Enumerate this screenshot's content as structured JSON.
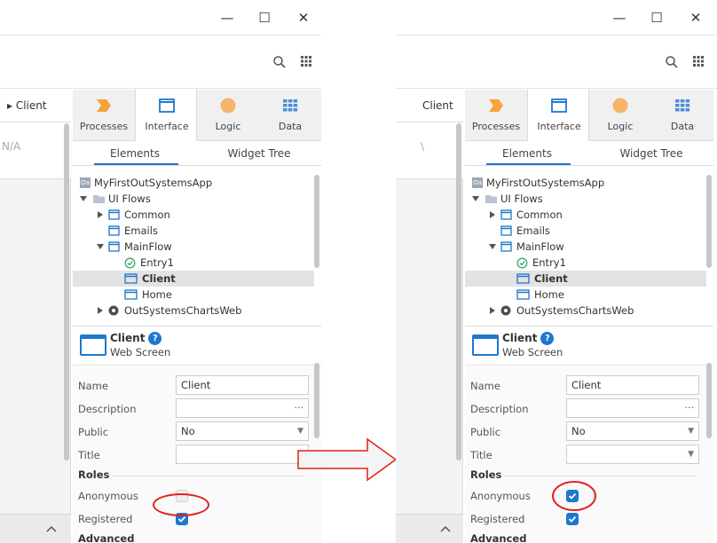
{
  "colors": {
    "accent": "#1f77d0",
    "annotation_red": "#e0201b",
    "processes_orange": "#f6a33a",
    "logic_orange": "#f5b56a"
  },
  "window": {
    "minimize_glyph": "—",
    "maximize_glyph": "☐",
    "close_glyph": "✕"
  },
  "toolbar": {
    "search_icon": "search-icon",
    "apps_icon": "grid-icon"
  },
  "left": {
    "editor_tab": "▸ Client",
    "editor_value": "N/A",
    "tabs": [
      "Processes",
      "Interface",
      "Logic",
      "Data"
    ],
    "subtabs": [
      "Elements",
      "Widget Tree"
    ],
    "tree": {
      "app_badge": "Oa",
      "app": "MyFirstOutSystemsApp",
      "ui_flows": "UI Flows",
      "common": "Common",
      "emails": "Emails",
      "mainflow": "MainFlow",
      "entry": "Entry1",
      "client": "Client",
      "home": "Home",
      "charts": "OutSystemsChartsWeb"
    },
    "screen": {
      "name": "Client",
      "type": "Web Screen",
      "help": "?"
    },
    "props": {
      "name_label": "Name",
      "name_value": "Client",
      "description_label": "Description",
      "description_ellipsis": "...",
      "public_label": "Public",
      "public_value": "No",
      "title_label": "Title",
      "roles_label": "Roles",
      "anonymous_label": "Anonymous",
      "registered_label": "Registered",
      "advanced_label": "Advanced"
    },
    "checkbox_anonymous": false,
    "checkbox_registered": true
  },
  "right": {
    "editor_tab": "Client",
    "editor_value": "\\",
    "tabs": [
      "Processes",
      "Interface",
      "Logic",
      "Data"
    ],
    "subtabs": [
      "Elements",
      "Widget Tree"
    ],
    "tree": {
      "app_badge": "Oa",
      "app": "MyFirstOutSystemsApp",
      "ui_flows": "UI Flows",
      "common": "Common",
      "emails": "Emails",
      "mainflow": "MainFlow",
      "entry": "Entry1",
      "client": "Client",
      "home": "Home",
      "charts": "OutSystemsChartsWeb"
    },
    "screen": {
      "name": "Client",
      "type": "Web Screen",
      "help": "?"
    },
    "props": {
      "name_label": "Name",
      "name_value": "Client",
      "description_label": "Description",
      "description_ellipsis": "...",
      "public_label": "Public",
      "public_value": "No",
      "title_label": "Title",
      "roles_label": "Roles",
      "anonymous_label": "Anonymous",
      "registered_label": "Registered",
      "advanced_label": "Advanced"
    },
    "checkbox_anonymous": true,
    "checkbox_registered": true
  }
}
